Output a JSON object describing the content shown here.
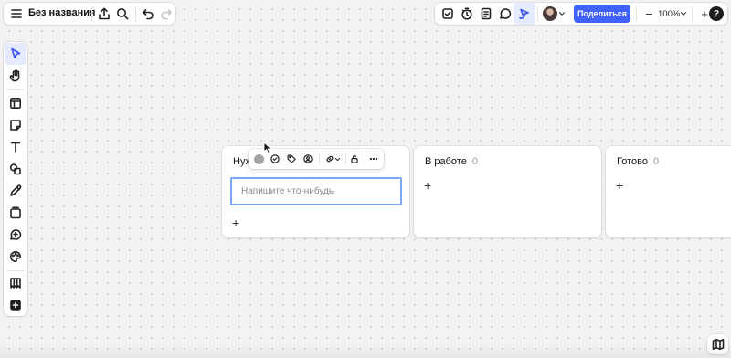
{
  "app": {
    "board_title": "Без названия"
  },
  "top_left_toolbar": {
    "icons": [
      "menu-icon",
      "upload-icon",
      "search-icon",
      "undo-icon",
      "redo-icon"
    ]
  },
  "top_right_toolbar": {
    "icons": [
      "checkbox-icon",
      "timer-icon",
      "notes-icon",
      "comment-icon",
      "cursor-presence-icon"
    ],
    "share_label": "Поделиться",
    "zoom_out_label": "−",
    "zoom_value": "100%",
    "zoom_in_label": "+",
    "help_label": "?"
  },
  "left_toolbar": {
    "tools": [
      "select-tool",
      "hand-tool",
      "templates-tool",
      "sticky-note-tool",
      "text-tool",
      "shapes-tool",
      "pen-tool",
      "frame-tool",
      "add-comment-tool",
      "color-tool",
      "kanban-tool",
      "more-tools"
    ],
    "active_tool": "select-tool"
  },
  "kanban": {
    "columns": [
      {
        "title": "Нуж",
        "count": "",
        "add_label": "+",
        "input_placeholder": "Напишите что-нибудь",
        "input_value": ""
      },
      {
        "title": "В работе",
        "count": "0",
        "add_label": "+"
      },
      {
        "title": "Готово",
        "count": "0",
        "add_label": "+"
      }
    ]
  },
  "context_toolbar": {
    "icons": [
      "color-dot",
      "check-circle-icon",
      "tag-icon",
      "assignee-icon",
      "link-icon",
      "lock-icon",
      "more-icon"
    ],
    "dot_color": "#a3a3a3"
  },
  "colors": {
    "accent": "#4262ff",
    "active_tool_bg": "#e6eaff",
    "input_border": "#7ba7f7"
  }
}
